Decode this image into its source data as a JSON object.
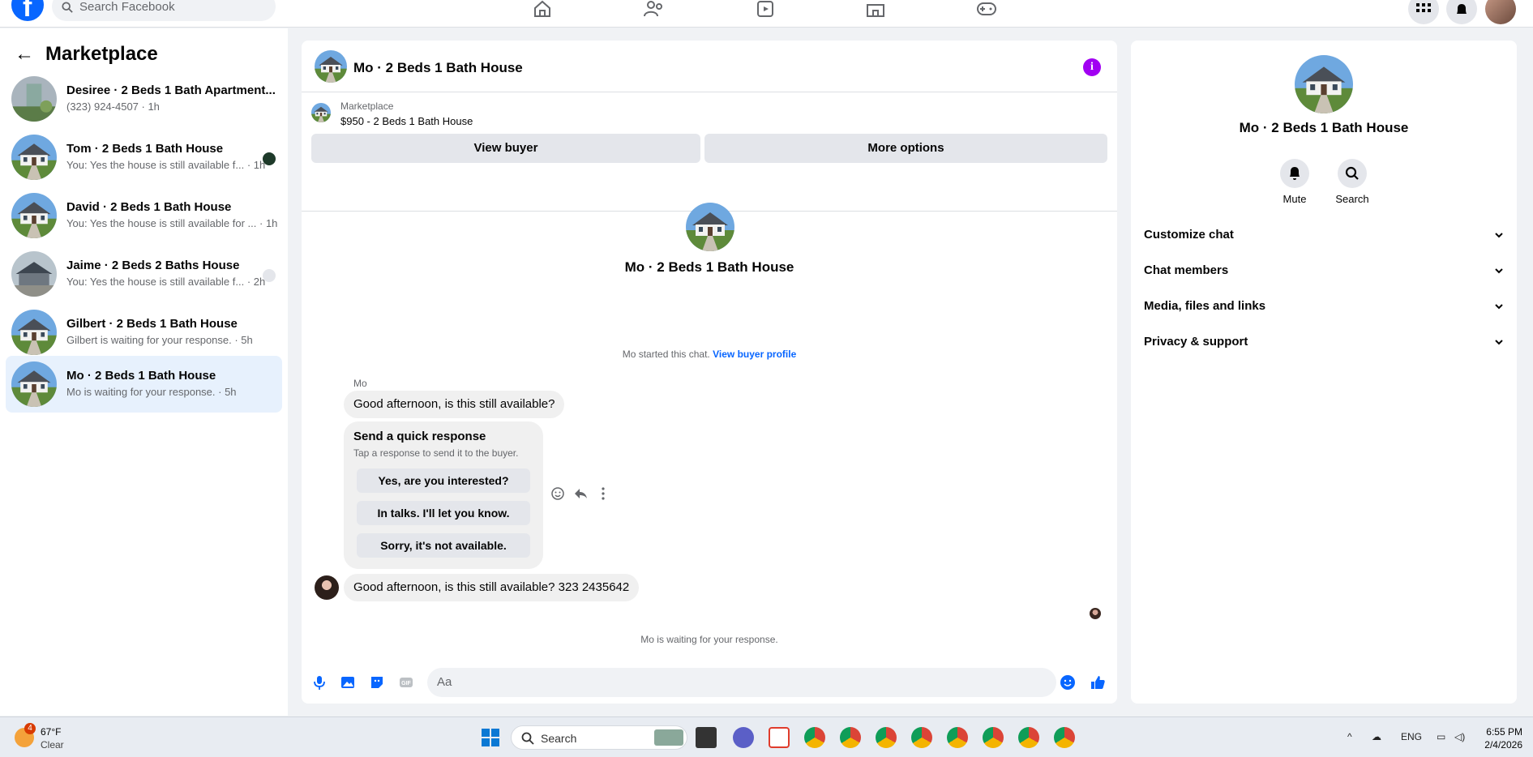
{
  "header": {
    "search_placeholder": "Search Facebook"
  },
  "sidebar": {
    "title": "Marketplace",
    "conversations": [
      {
        "name": "Desiree · 2 Beds 1 Bath Apartment...",
        "sub": "(323) 924-4507 · 1h"
      },
      {
        "name": "Tom · 2 Beds 1 Bath House",
        "sub": "You: Yes the house is still available f... · 1h"
      },
      {
        "name": "David · 2 Beds 1 Bath House",
        "sub": "You: Yes the house is still available for ... · 1h"
      },
      {
        "name": "Jaime · 2 Beds 2 Baths House",
        "sub": "You: Yes the house is still available f... · 2h"
      },
      {
        "name": "Gilbert · 2 Beds 1 Bath House",
        "sub": "Gilbert is waiting for your response. · 5h"
      },
      {
        "name": "Mo · 2 Beds 1 Bath House",
        "sub": "Mo is waiting for your response. · 5h"
      }
    ]
  },
  "chat": {
    "title": "Mo · 2 Beds 1 Bath House",
    "listing_source": "Marketplace",
    "listing_title": "$950 - 2 Beds 1 Bath House",
    "view_buyer": "View buyer",
    "more_options": "More options",
    "hero_name": "Mo · 2 Beds 1 Bath House",
    "started_text": "Mo started this chat.",
    "view_buyer_profile": "View buyer profile",
    "sender_name": "Mo",
    "msg1": "Good afternoon, is this still available?",
    "quick_title": "Send a quick response",
    "quick_sub": "Tap a response to send it to the buyer.",
    "quick_options": [
      "Yes, are you interested?",
      "In talks. I'll let you know.",
      "Sorry, it's not available."
    ],
    "msg2": "Good afternoon, is this still available? 323 2435642",
    "waiting": "Mo is waiting for your response.",
    "composer_placeholder": "Aa"
  },
  "details": {
    "name": "Mo · 2 Beds 1 Bath House",
    "mute": "Mute",
    "search": "Search",
    "sections": [
      "Customize chat",
      "Chat members",
      "Media, files and links",
      "Privacy & support"
    ]
  },
  "taskbar": {
    "weather_badge": "4",
    "temp": "67°F",
    "condition": "Clear",
    "search": "Search",
    "lang": "ENG",
    "time": "6:55 PM",
    "date": "2/4/2026"
  },
  "colors": {
    "accent": "#0866ff",
    "info": "#a100f2",
    "active_row": "#e7f1fd"
  }
}
